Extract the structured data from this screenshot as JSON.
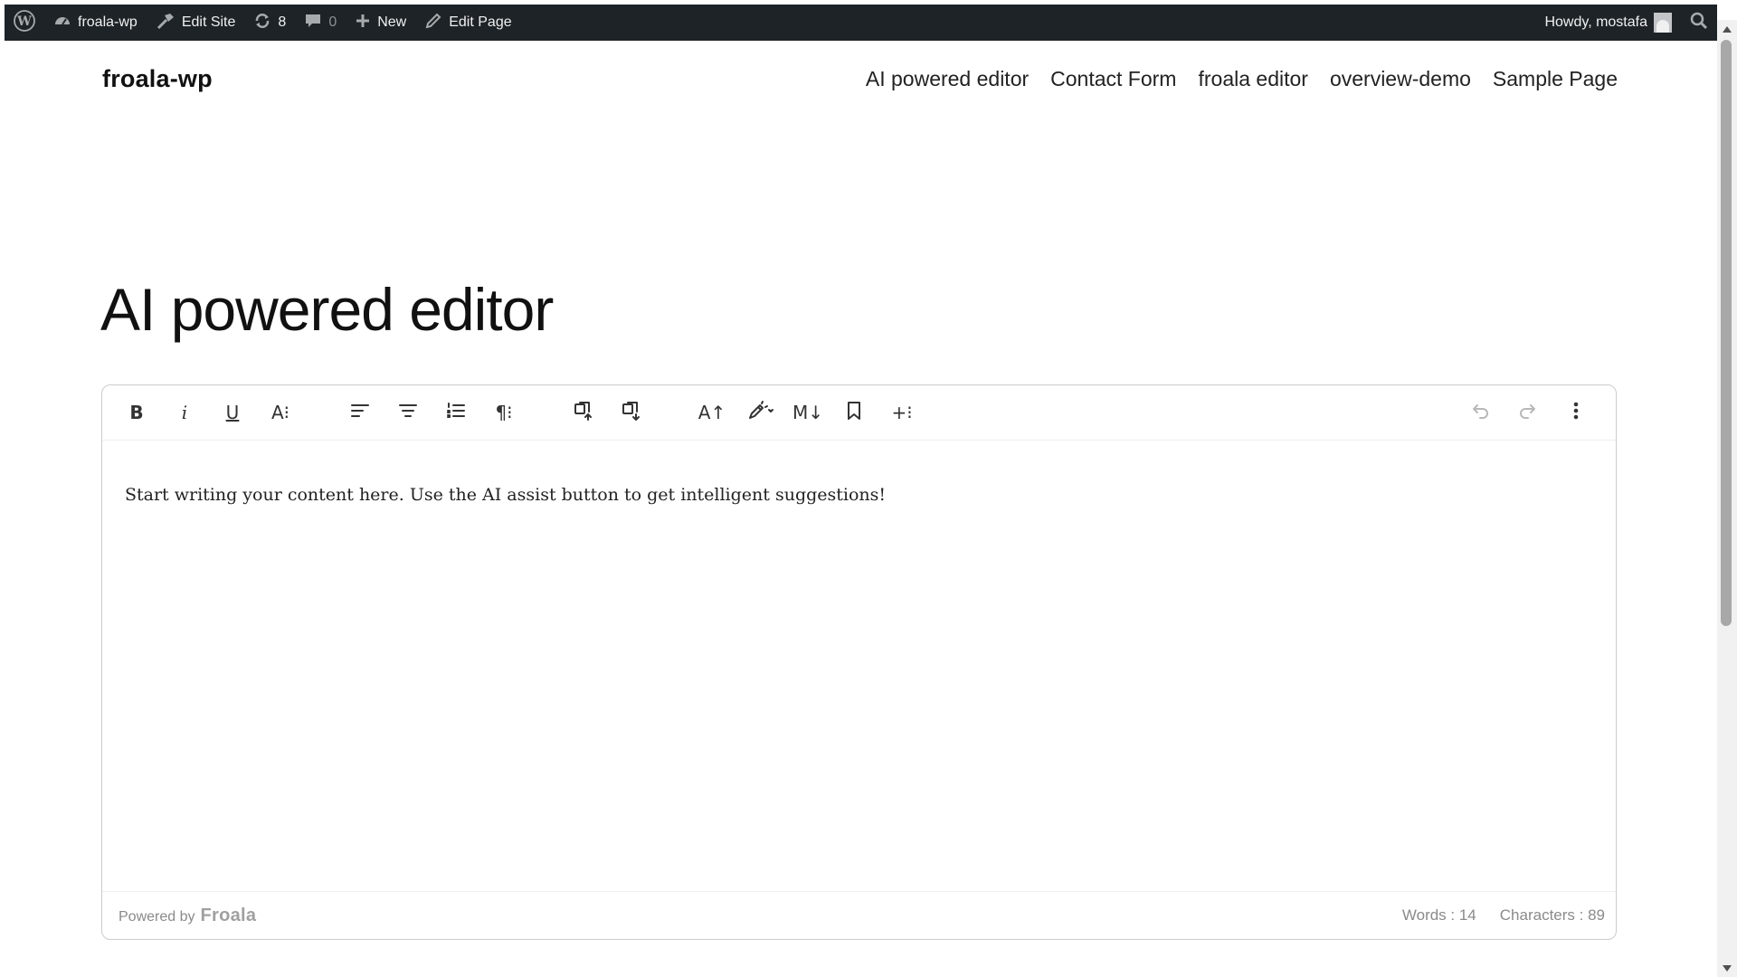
{
  "admin_bar": {
    "site_name": "froala-wp",
    "edit_site": "Edit Site",
    "updates_count": "8",
    "comments_count": "0",
    "new_label": "New",
    "edit_page": "Edit Page",
    "greeting": "Howdy, mostafa",
    "icons": [
      "wordpress-logo-icon",
      "dashboard-icon",
      "hammer-icon",
      "refresh-icon",
      "comment-icon",
      "plus-icon",
      "pencil-icon",
      "avatar-icon",
      "search-icon"
    ]
  },
  "site": {
    "title": "froala-wp",
    "nav": [
      "AI powered editor",
      "Contact Form",
      "froala editor",
      "overview-demo",
      "Sample Page"
    ]
  },
  "page": {
    "title": "AI powered editor"
  },
  "editor": {
    "toolbar_buttons": [
      "bold",
      "italic",
      "underline",
      "text-more",
      "align-left",
      "align-center",
      "ordered-list",
      "paragraph-more",
      "import-word",
      "export-word",
      "ai-text",
      "ai-assist",
      "markdown",
      "bookmark",
      "insert-more",
      "undo",
      "redo",
      "more-options"
    ],
    "content": "Start writing your content here. Use the AI assist button to get intelligent suggestions!",
    "powered_by": "Powered by",
    "brand": "Froala",
    "words": "Words : 14",
    "characters": "Characters : 89"
  },
  "colors": {
    "admin_bar_bg": "#1d2327",
    "admin_bar_text": "#f0f0f1",
    "editor_border": "#cccccc"
  }
}
